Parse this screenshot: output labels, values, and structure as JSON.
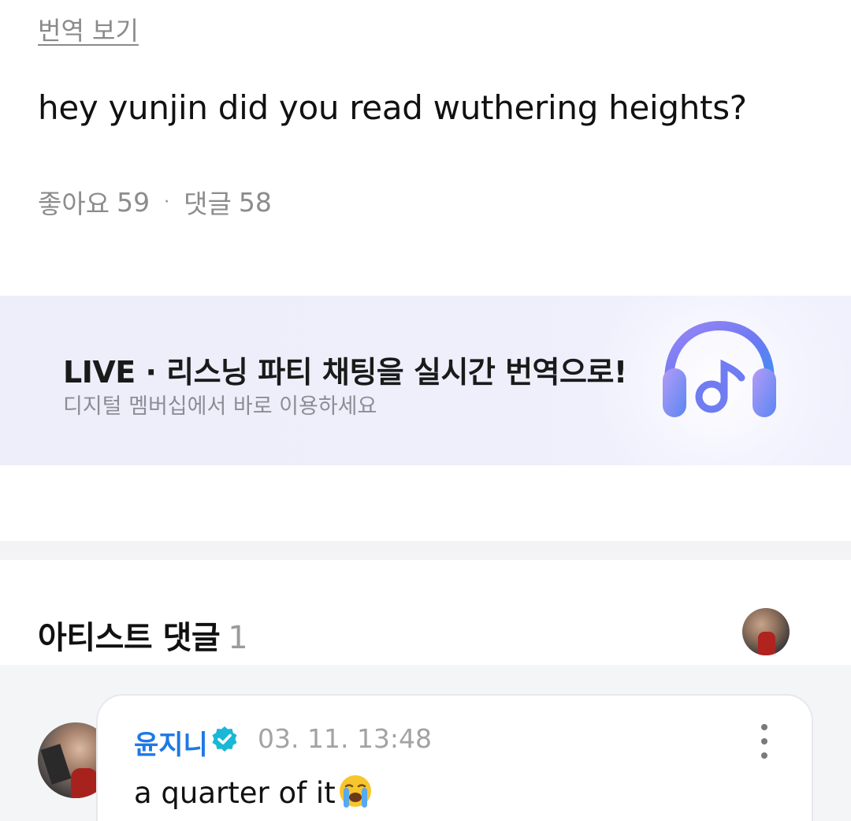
{
  "post": {
    "translate_link": "번역 보기",
    "body": "hey yunjin did you read wuthering heights?",
    "likes_label": "좋아요",
    "likes_count": "59",
    "separator": "·",
    "comments_label": "댓글",
    "comments_count": "58"
  },
  "banner": {
    "title": "LIVE · 리스닝 파티 채팅을 실시간 번역으로!",
    "subtitle": "디지털 멤버십에서 바로 이용하세요",
    "icon": "headphones-music-icon",
    "accent_colors": [
      "#7b6cf0",
      "#4a8df0"
    ]
  },
  "artist_comments": {
    "title": "아티스트 댓글",
    "count": "1",
    "items": [
      {
        "author": "윤지니",
        "verified": true,
        "timestamp": "03. 11. 13:48",
        "text": "a quarter of it",
        "emoji": "loudly-crying-face-icon"
      }
    ]
  },
  "colors": {
    "author_blue": "#1e78e6",
    "verified_badge": "#18b8d6",
    "muted_text": "#8c8c8c"
  }
}
